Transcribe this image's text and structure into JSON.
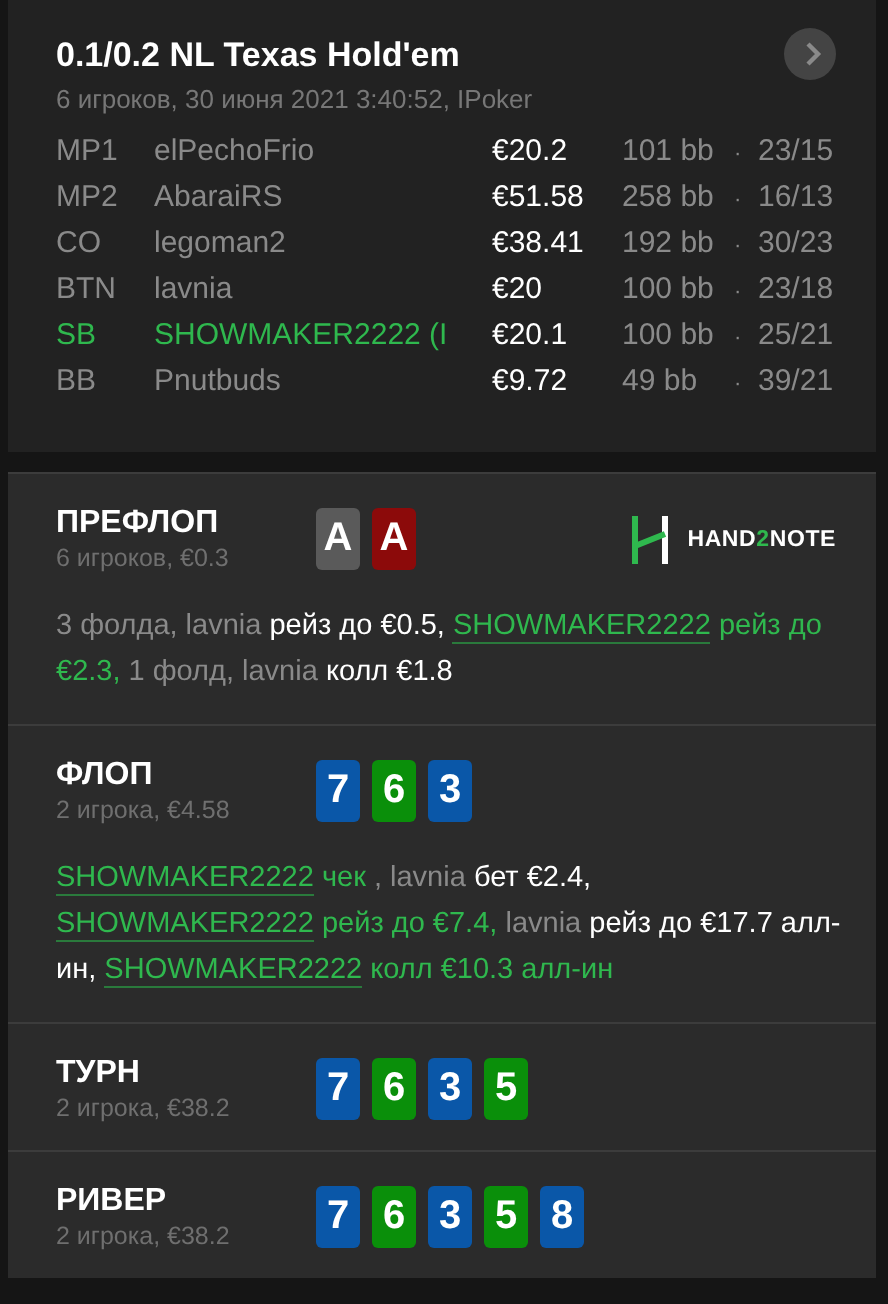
{
  "header": {
    "title": "0.1/0.2 NL Texas Hold'em",
    "subtitle": "6 игроков, 30 июня 2021 3:40:52, IPoker"
  },
  "players": [
    {
      "position": "MP1",
      "name": "elPechoFrio",
      "stack": "€20.2",
      "bb": "101 bb",
      "separator": "·",
      "stats": "23/15",
      "hero": false
    },
    {
      "position": "MP2",
      "name": "AbaraiRS",
      "stack": "€51.58",
      "bb": "258 bb",
      "separator": "·",
      "stats": "16/13",
      "hero": false
    },
    {
      "position": "CO",
      "name": "legoman2",
      "stack": "€38.41",
      "bb": "192 bb",
      "separator": "·",
      "stats": "30/23",
      "hero": false
    },
    {
      "position": "BTN",
      "name": "lavnia",
      "stack": "€20",
      "bb": "100 bb",
      "separator": "·",
      "stats": "23/18",
      "hero": false
    },
    {
      "position": "SB",
      "name": "SHOWMAKER2222 (I",
      "stack": "€20.1",
      "bb": "100 bb",
      "separator": "·",
      "stats": "25/21",
      "hero": true
    },
    {
      "position": "BB",
      "name": "Pnutbuds",
      "stack": "€9.72",
      "bb": "49 bb",
      "separator": "·",
      "stats": "39/21",
      "hero": false
    }
  ],
  "logo": {
    "parts": [
      "HAND",
      "2",
      "NOTE"
    ]
  },
  "streets": [
    {
      "title": "ПРЕФЛОП",
      "subtitle": "6 игроков, €0.3",
      "cards": [
        {
          "rank": "A",
          "color": "#5a5a5a"
        },
        {
          "rank": "A",
          "color": "#8c0a0a"
        }
      ],
      "actions": [
        {
          "kind": "muted",
          "text": "3 фолда, lavnia "
        },
        {
          "kind": "action",
          "text": "рейз до €0.5, "
        },
        {
          "kind": "hero",
          "text": "SHOWMAKER2222"
        },
        {
          "kind": "hero_action",
          "text": " рейз до €2.3,"
        },
        {
          "kind": "muted",
          "text": " 1 фолд, lavnia "
        },
        {
          "kind": "action",
          "text": "колл €1.8"
        }
      ]
    },
    {
      "title": "ФЛОП",
      "subtitle": "2 игрока, €4.58",
      "cards": [
        {
          "rank": "7",
          "color": "#0a57a8"
        },
        {
          "rank": "6",
          "color": "#0a8f0a"
        },
        {
          "rank": "3",
          "color": "#0a57a8"
        }
      ],
      "actions": [
        {
          "kind": "hero",
          "text": "SHOWMAKER2222"
        },
        {
          "kind": "hero_action",
          "text": " чек"
        },
        {
          "kind": "muted",
          "text": " , lavnia "
        },
        {
          "kind": "action",
          "text": "бет €2.4, "
        },
        {
          "kind": "hero",
          "text": "SHOWMAKER2222"
        },
        {
          "kind": "hero_action",
          "text": " рейз до €7.4,"
        },
        {
          "kind": "muted",
          "text": " lavnia "
        },
        {
          "kind": "action",
          "text": "рейз до €17.7 алл-ин, "
        },
        {
          "kind": "hero",
          "text": "SHOWMAKER2222"
        },
        {
          "kind": "hero_action",
          "text": " колл €10.3 алл-ин"
        }
      ]
    },
    {
      "title": "ТУРН",
      "subtitle": "2 игрока, €38.2",
      "cards": [
        {
          "rank": "7",
          "color": "#0a57a8"
        },
        {
          "rank": "6",
          "color": "#0a8f0a"
        },
        {
          "rank": "3",
          "color": "#0a57a8"
        },
        {
          "rank": "5",
          "color": "#0a8f0a"
        }
      ]
    },
    {
      "title": "РИВЕР",
      "subtitle": "2 игрока, €38.2",
      "cards": [
        {
          "rank": "7",
          "color": "#0a57a8"
        },
        {
          "rank": "6",
          "color": "#0a8f0a"
        },
        {
          "rank": "3",
          "color": "#0a57a8"
        },
        {
          "rank": "5",
          "color": "#0a8f0a"
        },
        {
          "rank": "8",
          "color": "#0a57a8"
        }
      ]
    }
  ]
}
